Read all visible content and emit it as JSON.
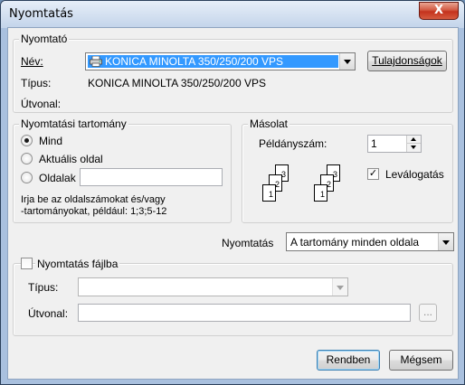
{
  "window": {
    "title": "Nyomtatás",
    "close_symbol": "X"
  },
  "printer_group": {
    "legend": "Nyomtató",
    "name_label": "Név:",
    "printer_name": "KONICA MINOLTA 350/250/200 VPS",
    "properties_button": "Tulajdonságok",
    "type_label": "Típus:",
    "type_value": "KONICA MINOLTA 350/250/200 VPS",
    "path_label": "Útvonal:",
    "path_value": ""
  },
  "range_group": {
    "legend": "Nyomtatási tartomány",
    "options": [
      "Mind",
      "Aktuális oldal",
      "Oldalak"
    ],
    "selected": "Mind",
    "pages_value": "",
    "hint_line1": "Irja be az oldalszámokat és/vagy",
    "hint_line2": "-tartományokat, például: 1;3;5-12"
  },
  "copies_group": {
    "legend": "Másolat",
    "copies_label": "Példányszám:",
    "copies_value": "1",
    "collate_label": "Leválogatás",
    "collate_checked": true,
    "page_numbers": [
      "1",
      "2",
      "3"
    ]
  },
  "print_what": {
    "label": "Nyomtatás",
    "value": "A tartomány minden oldala"
  },
  "file_group": {
    "legend": "Nyomtatás fájlba",
    "checked": false,
    "type_label": "Típus:",
    "type_value": "",
    "path_label": "Útvonal:",
    "path_value": "",
    "browse_label": "..."
  },
  "buttons": {
    "ok": "Rendben",
    "cancel": "Mégsem"
  }
}
